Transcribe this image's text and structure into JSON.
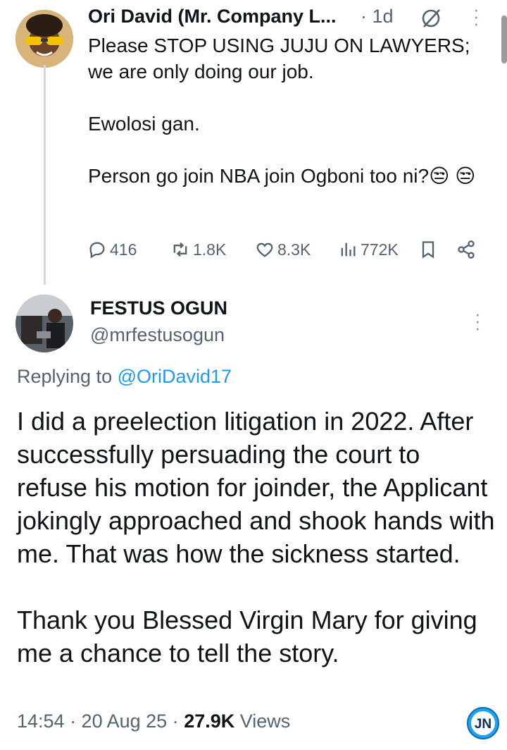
{
  "tweet1": {
    "author_name": "Ori David (Mr. Company L...",
    "time": "· 1d",
    "lines": [
      "Please STOP USING JUJU ON LAWYERS; we are only doing our job.",
      "Ewolosi gan.",
      "Person go join NBA join Ogboni too ni?😒 😒"
    ],
    "replies": "416",
    "reposts": "1.8K",
    "likes": "8.3K",
    "views": "772K"
  },
  "tweet2": {
    "author_name": "FESTUS OGUN",
    "handle": "@mrfestusogun",
    "replying_prefix": "Replying to",
    "replying_to": "@OriDavid17",
    "paragraph1": "I did a preelection litigation in 2022. After successfully persuading the court to refuse his motion for joinder, the Applicant jokingly approached and shook hands with me. That was how the sickness started.",
    "paragraph2": "Thank you Blessed Virgin Mary for giving me a chance to tell the story.",
    "time": "14:54 · 20 Aug 25 ·",
    "views_count": "27.9K",
    "views_label": "Views"
  },
  "watermark": "JN",
  "colors": {
    "link": "#1d9bf0",
    "secondary": "#536471",
    "thread": "#cfd9de"
  }
}
